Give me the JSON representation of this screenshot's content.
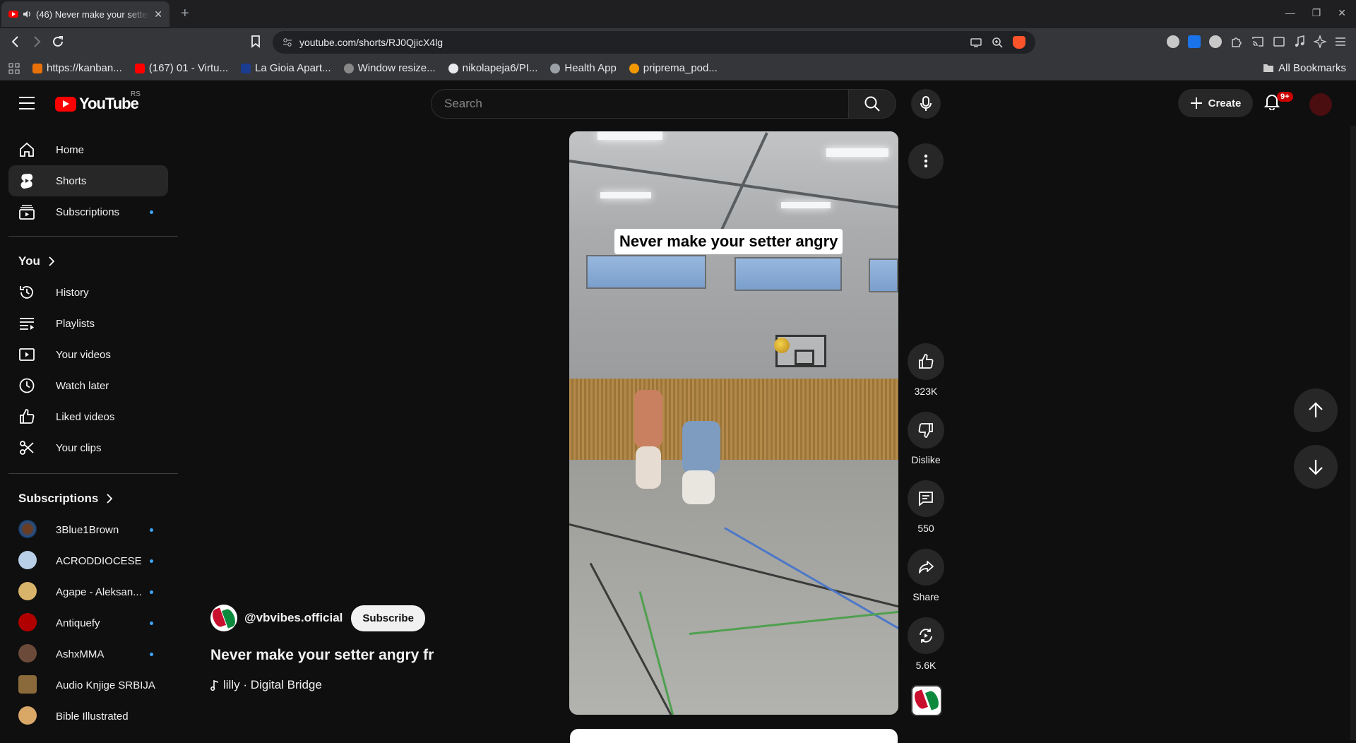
{
  "browser": {
    "tab_title": "(46) Never make your setter angry fr - YouTube",
    "url": "youtube.com/shorts/RJ0QjicX4lg",
    "bookmarks": [
      {
        "label": "https://kanban...",
        "color": "#e8710a"
      },
      {
        "label": "(167) 01 - Virtu...",
        "color": "#ff0000"
      },
      {
        "label": "La Gioia Apart...",
        "color": "#1a3d8f"
      },
      {
        "label": "Window resize...",
        "color": "#888888"
      },
      {
        "label": "nikolapeja6/PI...",
        "color": "#e8eaed"
      },
      {
        "label": "Health App",
        "color": "#9aa0a6"
      },
      {
        "label": "priprema_pod...",
        "color": "#f29900"
      }
    ],
    "all_bookmarks": "All Bookmarks"
  },
  "header": {
    "logo_text": "YouTube",
    "country_code": "RS",
    "search_placeholder": "Search",
    "create_label": "Create",
    "notif_badge": "9+"
  },
  "sidebar": {
    "main": [
      {
        "label": "Home",
        "icon": "home-icon"
      },
      {
        "label": "Shorts",
        "icon": "shorts-icon",
        "active": true
      },
      {
        "label": "Subscriptions",
        "icon": "subscriptions-icon",
        "new": true
      }
    ],
    "you_heading": "You",
    "you": [
      {
        "label": "History",
        "icon": "history-icon"
      },
      {
        "label": "Playlists",
        "icon": "playlists-icon"
      },
      {
        "label": "Your videos",
        "icon": "your-videos-icon"
      },
      {
        "label": "Watch later",
        "icon": "watch-later-icon"
      },
      {
        "label": "Liked videos",
        "icon": "liked-videos-icon"
      },
      {
        "label": "Your clips",
        "icon": "clips-icon"
      }
    ],
    "subs_heading": "Subscriptions",
    "subscriptions": [
      {
        "label": "3Blue1Brown",
        "new": true,
        "color": "#1f4f8a"
      },
      {
        "label": "ACRODDIOCESE",
        "new": true,
        "color": "#b9cfe8"
      },
      {
        "label": "Agape - Aleksan...",
        "new": true,
        "color": "#d8b36a"
      },
      {
        "label": "Antiquefy",
        "new": true,
        "color": "#b00000"
      },
      {
        "label": "AshxMMA",
        "new": true,
        "color": "#6b4a3a"
      },
      {
        "label": "Audio Knjige SRBIJA",
        "new": false,
        "color": "#8a6a3a"
      },
      {
        "label": "Bible Illustrated",
        "new": false,
        "color": "#d9a766"
      }
    ]
  },
  "short": {
    "overlay_caption": "Never make your setter angry",
    "channel": "@vbvibes.official",
    "subscribe_label": "Subscribe",
    "title": "Never make your setter angry fr",
    "music": "lilly · Digital Bridge",
    "likes": "323K",
    "dislike_label": "Dislike",
    "comments": "550",
    "share_label": "Share",
    "remix": "5.6K"
  }
}
